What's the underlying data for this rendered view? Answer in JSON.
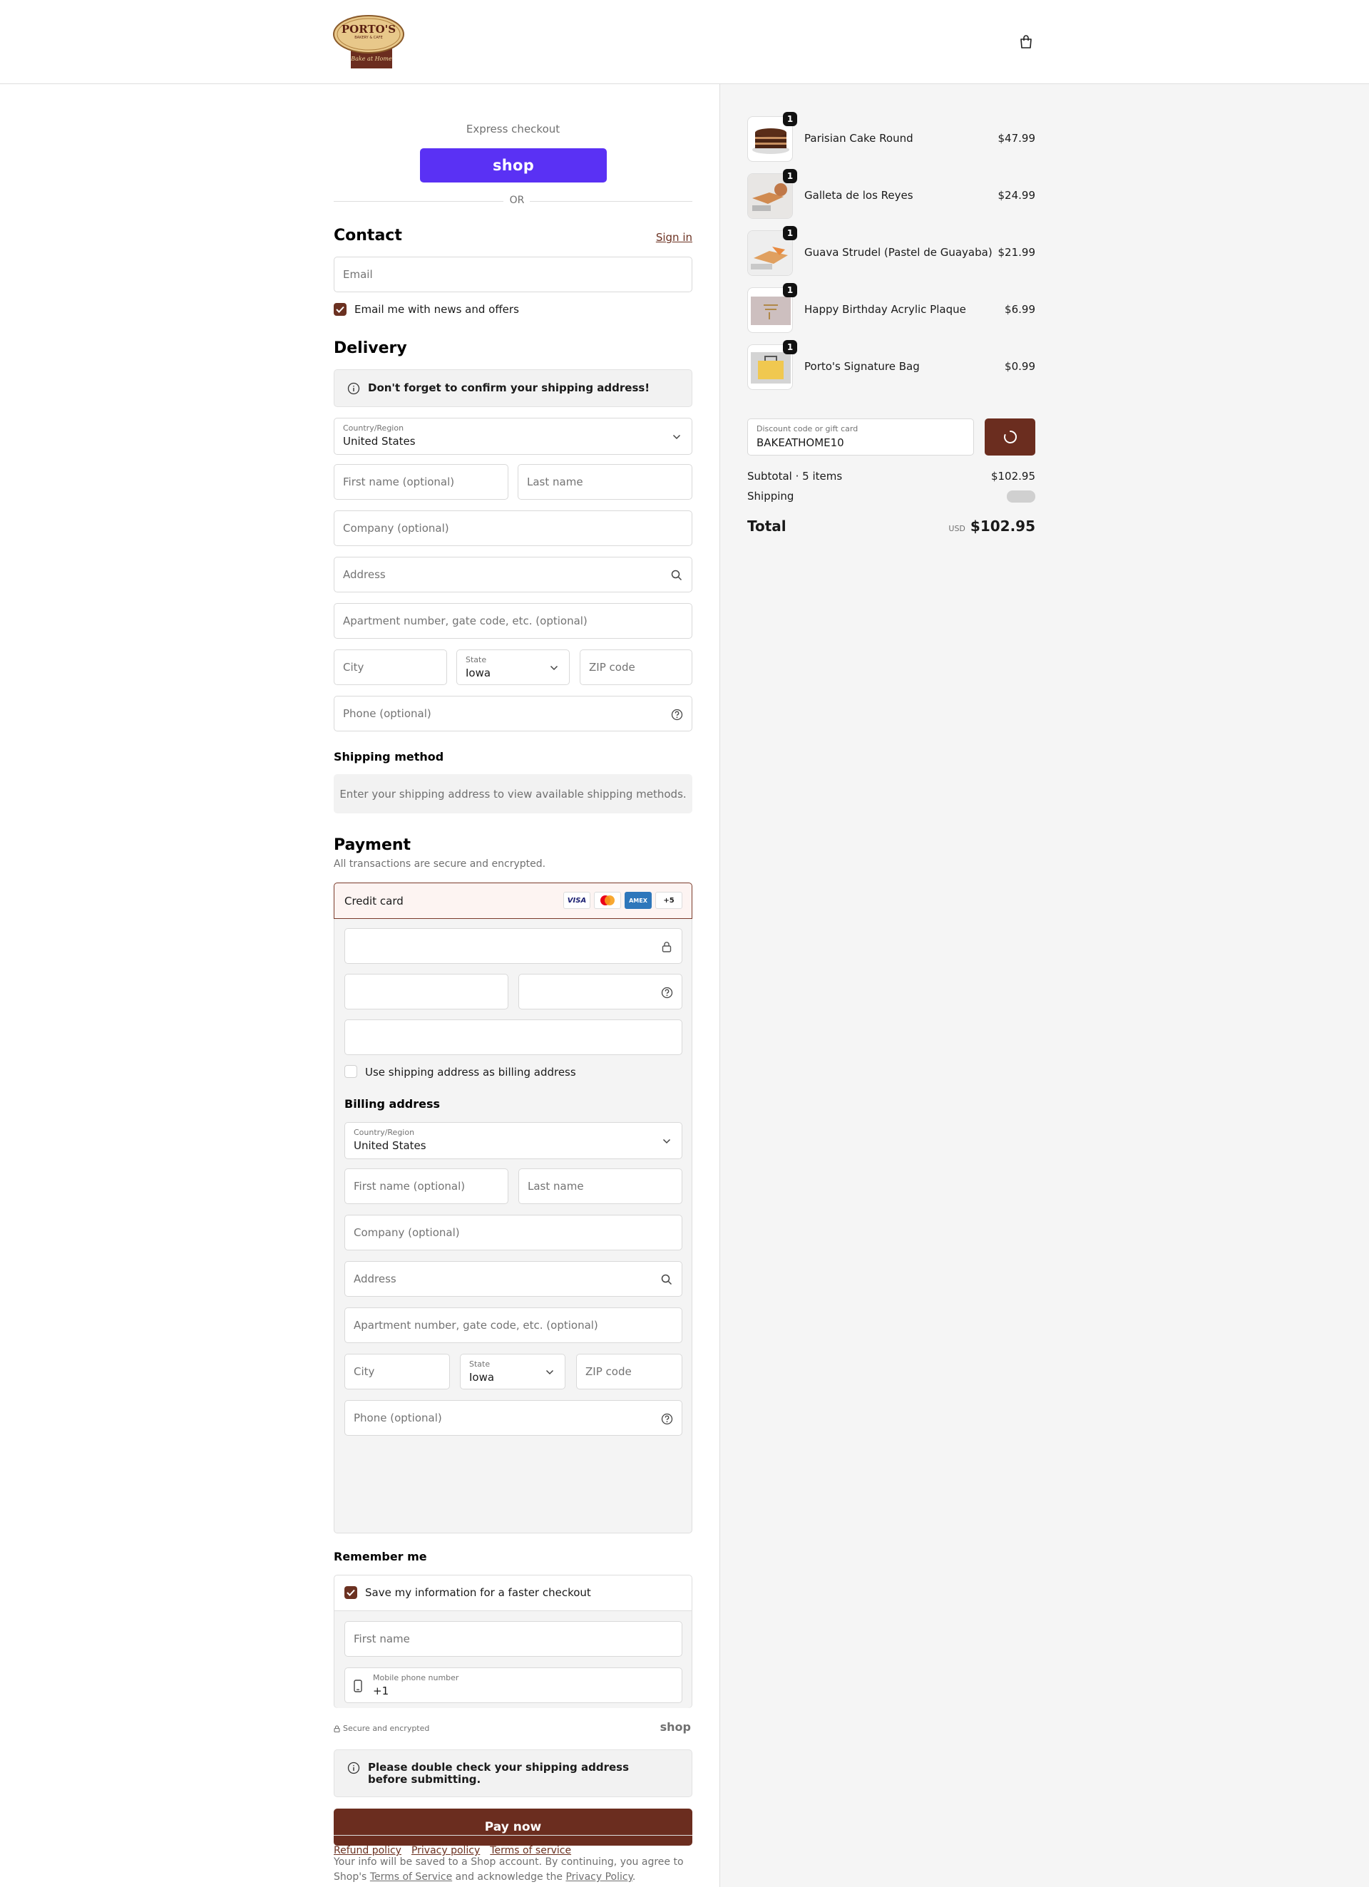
{
  "header": {
    "logo_name": "PORTO'S",
    "logo_sub": "BAKERY & CAFE",
    "logo_tag": "Bake at Home"
  },
  "express": {
    "title": "Express checkout",
    "shop_label": "shop",
    "or": "OR"
  },
  "contact": {
    "title": "Contact",
    "sign_in": "Sign in",
    "email_placeholder": "Email",
    "news_label": "Email me with news and offers"
  },
  "delivery": {
    "title": "Delivery",
    "notice": "Don't forget to confirm your shipping address!",
    "country_label": "Country/Region",
    "country_value": "United States",
    "first_name": "First name (optional)",
    "last_name": "Last name",
    "company": "Company (optional)",
    "address": "Address",
    "apartment": "Apartment number, gate code, etc. (optional)",
    "city": "City",
    "state_label": "State",
    "state_value": "Iowa",
    "zip": "ZIP code",
    "phone": "Phone (optional)"
  },
  "shipping": {
    "title": "Shipping method",
    "empty": "Enter your shipping address to view available shipping methods."
  },
  "payment": {
    "title": "Payment",
    "subtitle": "All transactions are secure and encrypted.",
    "method": "Credit card",
    "badges": [
      "VISA",
      "",
      "AMEX",
      "+5"
    ],
    "use_shipping": "Use shipping address as billing address",
    "billing_title": "Billing address",
    "country_label": "Country/Region",
    "country_value": "United States",
    "first_name": "First name (optional)",
    "last_name": "Last name",
    "company": "Company (optional)",
    "address": "Address",
    "apartment": "Apartment number, gate code, etc. (optional)",
    "city": "City",
    "state_label": "State",
    "state_value": "Iowa",
    "zip": "ZIP code",
    "phone": "Phone (optional)"
  },
  "remember": {
    "title": "Remember me",
    "save_label": "Save my information for a faster checkout",
    "first_name": "First name",
    "mobile_label": "Mobile phone number",
    "mobile_value": "+1",
    "secure": "Secure and encrypted",
    "shop": "shop"
  },
  "final_notice": "Please double check your shipping address before submitting.",
  "pay_now": "Pay now",
  "legal": {
    "line1": "Your info will be saved to a Shop account. By continuing, you agree to",
    "prefix": "Shop's ",
    "tos": "Terms of Service",
    "middle": " and acknowledge the ",
    "privacy": "Privacy Policy",
    "suffix": "."
  },
  "footer": {
    "refund": "Refund policy",
    "privacy": "Privacy policy",
    "terms": "Terms of service"
  },
  "cart": {
    "items": [
      {
        "name": "Parisian Cake Round",
        "price": "$47.99",
        "qty": "1"
      },
      {
        "name": "Galleta de los Reyes",
        "price": "$24.99",
        "qty": "1"
      },
      {
        "name": "Guava Strudel (Pastel de Guayaba)",
        "price": "$21.99",
        "qty": "1"
      },
      {
        "name": "Happy Birthday Acrylic Plaque",
        "price": "$6.99",
        "qty": "1"
      },
      {
        "name": "Porto's Signature Bag",
        "price": "$0.99",
        "qty": "1"
      }
    ],
    "discount_label": "Discount code or gift card",
    "discount_value": "BAKEATHOME10",
    "subtotal_label": "Subtotal · 5 items",
    "subtotal_value": "$102.95",
    "shipping_label": "Shipping",
    "total_label": "Total",
    "currency": "USD",
    "total_value": "$102.95"
  },
  "colors": {
    "accent": "#6b2d1f",
    "shop": "#5a31f4"
  }
}
